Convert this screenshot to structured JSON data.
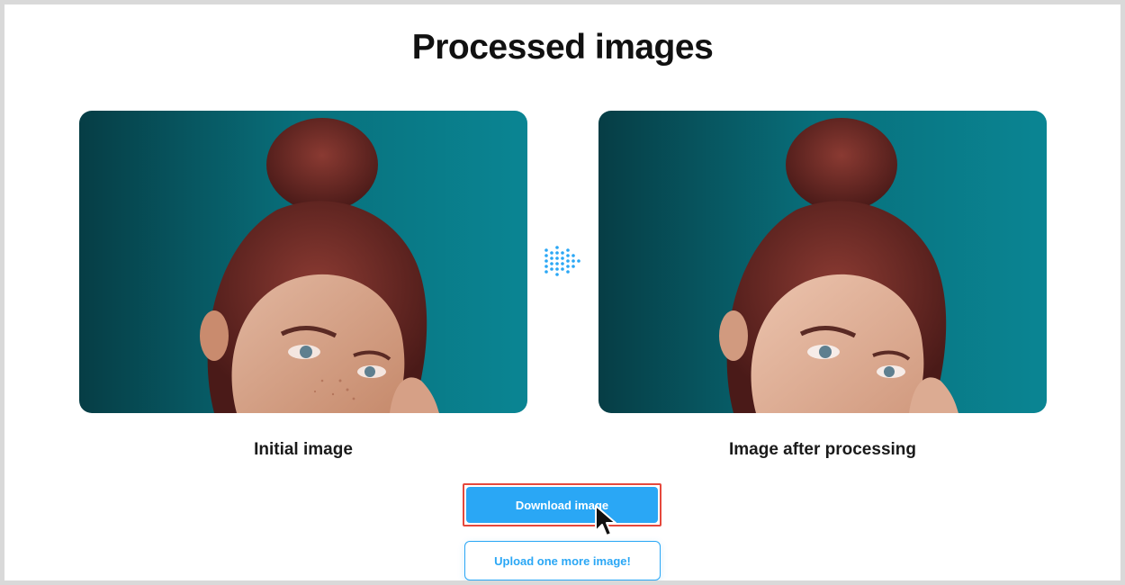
{
  "page": {
    "title": "Processed images"
  },
  "images": {
    "initial_caption": "Initial image",
    "processed_caption": "Image after processing"
  },
  "actions": {
    "download_label": "Download image",
    "upload_label": "Upload one more image!"
  },
  "colors": {
    "accent": "#2aa7f5",
    "highlight_border": "#e5483c",
    "photo_background": "#07717e"
  },
  "icons": {
    "transform_arrow": "dotted-arrow-right-icon",
    "cursor": "mouse-pointer-icon"
  }
}
